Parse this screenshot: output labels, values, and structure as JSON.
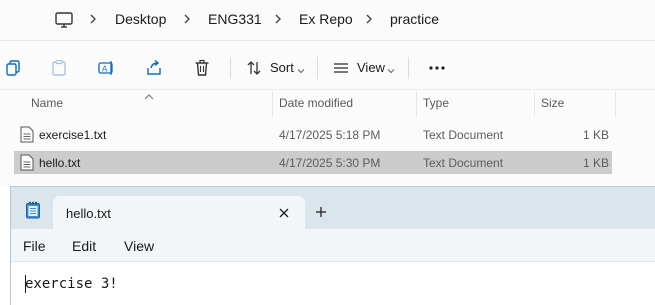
{
  "explorer": {
    "breadcrumb": [
      "Desktop",
      "ENG331",
      "Ex Repo",
      "practice"
    ],
    "toolbar": {
      "sort_label": "Sort",
      "view_label": "View",
      "icons": [
        "copy-icon",
        "paste-icon",
        "rename-icon",
        "share-icon",
        "delete-icon",
        "sort-icon",
        "view-icon",
        "more-icon"
      ]
    },
    "columns": {
      "name": "Name",
      "date": "Date modified",
      "type": "Type",
      "size": "Size"
    },
    "files": [
      {
        "name": "exercise1.txt",
        "date": "4/17/2025 5:18 PM",
        "type": "Text Document",
        "size": "1 KB",
        "selected": false
      },
      {
        "name": "hello.txt",
        "date": "4/17/2025 5:30 PM",
        "type": "Text Document",
        "size": "1 KB",
        "selected": true
      }
    ]
  },
  "notepad": {
    "tab_title": "hello.txt",
    "menu": [
      "File",
      "Edit",
      "View"
    ],
    "content": "exercise 3!"
  }
}
